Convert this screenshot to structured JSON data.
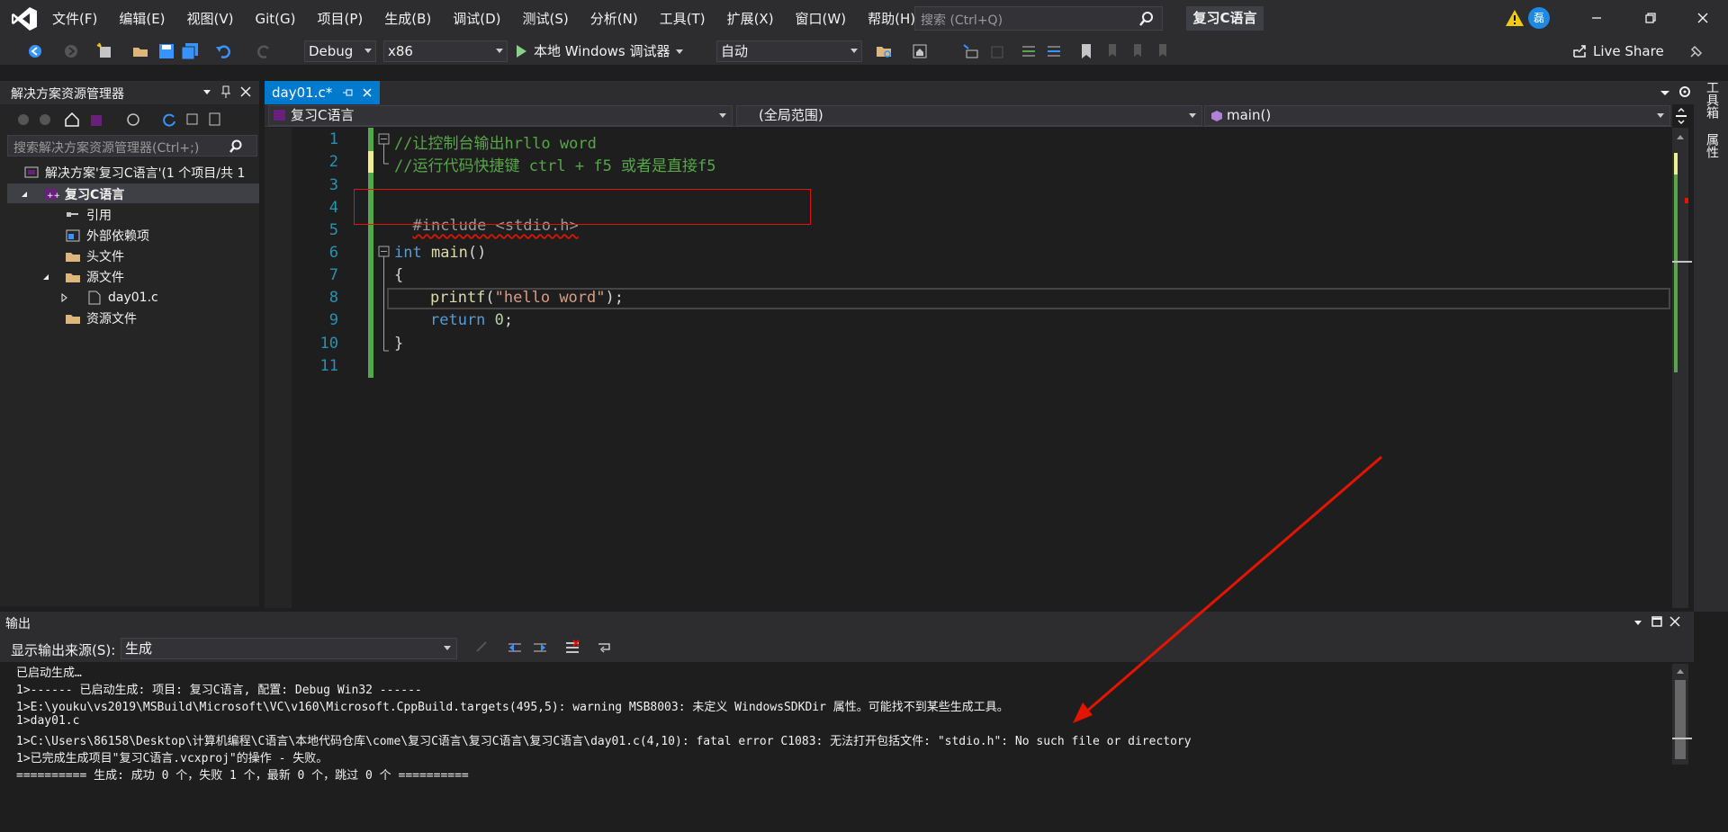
{
  "menu": {
    "items": [
      "文件(F)",
      "编辑(E)",
      "视图(V)",
      "Git(G)",
      "项目(P)",
      "生成(B)",
      "调试(D)",
      "测试(S)",
      "分析(N)",
      "工具(T)",
      "扩展(X)",
      "窗口(W)",
      "帮助(H)"
    ]
  },
  "search": {
    "placeholder": "搜索 (Ctrl+Q)"
  },
  "solution_name": "复习C语言",
  "user_avatar": "磊",
  "toolbar": {
    "config": "Debug",
    "platform": "x86",
    "run_label": "本地 Windows 调试器",
    "mode": "自动",
    "live_share": "Live Share"
  },
  "solution_explorer": {
    "title": "解决方案资源管理器",
    "search_placeholder": "搜索解决方案资源管理器(Ctrl+;)",
    "items": [
      {
        "label": "解决方案'复习C语言'(1 个项目/共 1"
      },
      {
        "label": "复习C语言"
      },
      {
        "label": "引用"
      },
      {
        "label": "外部依赖项"
      },
      {
        "label": "头文件"
      },
      {
        "label": "源文件"
      },
      {
        "label": "day01.c"
      },
      {
        "label": "资源文件"
      }
    ]
  },
  "editor": {
    "tab_label": "day01.c*",
    "nav_project": "复习C语言",
    "nav_scope": "(全局范围)",
    "nav_member": "main()",
    "line_numbers": [
      "1",
      "2",
      "3",
      "4",
      "5",
      "6",
      "7",
      "8",
      "9",
      "10",
      "11"
    ],
    "code": {
      "l1": "//让控制台输出hrllo word",
      "l2": "//运行代码快捷键 ctrl + f5 或者是直接f5",
      "l4": "#include <stdio.h>",
      "l6_key": "int",
      "l6_fn": " main",
      "l6_rest": "()",
      "l7": "{",
      "l8_fn": "printf",
      "l8_open": "(",
      "l8_str": "\"hello word\"",
      "l8_close": ");",
      "l9_key": "return",
      "l9_num": " 0",
      "l9_rest": ";",
      "l10": "}"
    }
  },
  "right_tabs": [
    "工具箱",
    "属性"
  ],
  "output": {
    "title": "输出",
    "source_label": "显示输出来源(S):",
    "source_value": "生成",
    "lines": [
      "已启动生成…",
      "1>------ 已启动生成: 项目: 复习C语言, 配置: Debug Win32 ------",
      "1>E:\\youku\\vs2019\\MSBuild\\Microsoft\\VC\\v160\\Microsoft.CppBuild.targets(495,5): warning MSB8003: 未定义 WindowsSDKDir 属性。可能找不到某些生成工具。",
      "1>day01.c",
      "1>C:\\Users\\86158\\Desktop\\计算机编程\\C语言\\本地代码仓库\\come\\复习C语言\\复习C语言\\复习C语言\\day01.c(4,10): fatal error C1083: 无法打开包括文件: \"stdio.h\": No such file or directory",
      "1>已完成生成项目\"复习C语言.vcxproj\"的操作 - 失败。",
      "========== 生成: 成功 0 个，失败 1 个，最新 0 个，跳过 0 个 =========="
    ]
  },
  "colors": {
    "accent": "#007acc",
    "annotation_red": "#e51400",
    "comment": "#57a64a",
    "keyword": "#569cd6"
  }
}
